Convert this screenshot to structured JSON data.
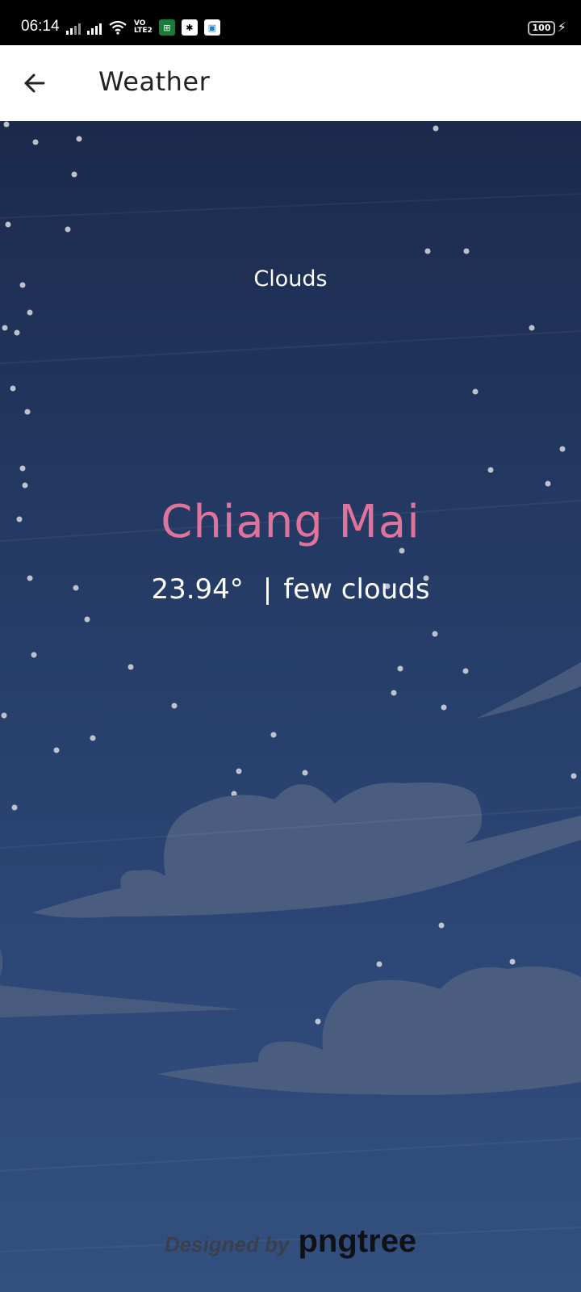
{
  "status_bar": {
    "time": "06:14",
    "volte_label": "VO\nLTE2",
    "battery": "100"
  },
  "app_bar": {
    "title": "Weather",
    "back_icon": "arrow-left-icon"
  },
  "weather": {
    "condition": "Clouds",
    "city": "Chiang Mai",
    "temperature": "23.94°",
    "separator": "|",
    "description": "few clouds"
  },
  "credit": {
    "designed_by": "Designed by",
    "brand": "pngtree"
  },
  "colors": {
    "city": "#e07399",
    "sky_top": "#1b2a4b",
    "sky_bottom": "#33507e",
    "cloud": "#4d5f7f"
  }
}
